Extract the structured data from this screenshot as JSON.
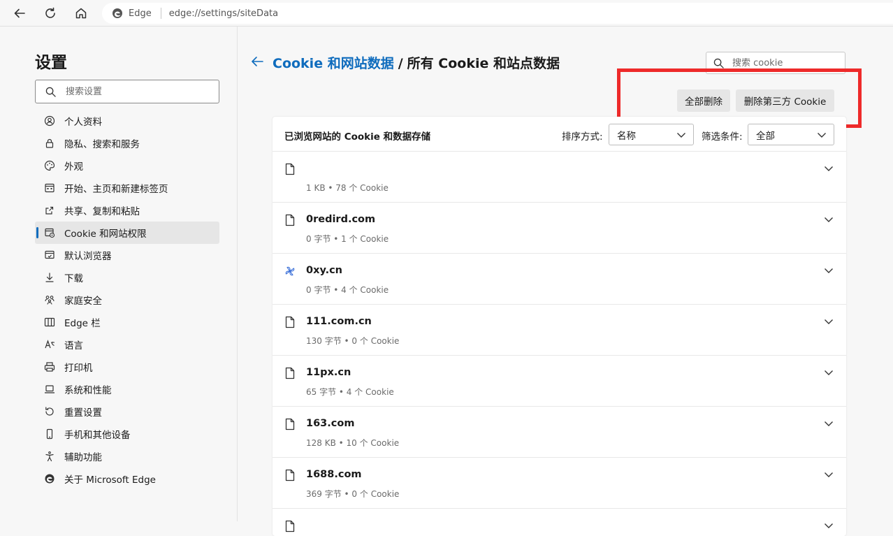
{
  "browser": {
    "site_label": "Edge",
    "url": "edge://settings/siteData"
  },
  "sidebar": {
    "title": "设置",
    "search_placeholder": "搜索设置",
    "items": [
      {
        "label": "个人资料",
        "icon": "profile-icon"
      },
      {
        "label": "隐私、搜索和服务",
        "icon": "lock-icon"
      },
      {
        "label": "外观",
        "icon": "palette-icon"
      },
      {
        "label": "开始、主页和新建标签页",
        "icon": "start-page-icon"
      },
      {
        "label": "共享、复制和粘贴",
        "icon": "share-icon"
      },
      {
        "label": "Cookie 和网站权限",
        "icon": "site-permissions-icon",
        "active": true
      },
      {
        "label": "默认浏览器",
        "icon": "default-browser-icon"
      },
      {
        "label": "下载",
        "icon": "download-icon"
      },
      {
        "label": "家庭安全",
        "icon": "family-icon"
      },
      {
        "label": "Edge 栏",
        "icon": "edge-bar-icon"
      },
      {
        "label": "语言",
        "icon": "language-icon"
      },
      {
        "label": "打印机",
        "icon": "printer-icon"
      },
      {
        "label": "系统和性能",
        "icon": "laptop-icon"
      },
      {
        "label": "重置设置",
        "icon": "reset-icon"
      },
      {
        "label": "手机和其他设备",
        "icon": "phone-icon"
      },
      {
        "label": "辅助功能",
        "icon": "accessibility-icon"
      },
      {
        "label": "关于 Microsoft Edge",
        "icon": "edge-logo-icon"
      }
    ]
  },
  "main": {
    "breadcrumb_link": "Cookie 和网站数据",
    "breadcrumb_sep": "/",
    "breadcrumb_current": "所有 Cookie 和站点数据",
    "search_placeholder": "搜索 cookie",
    "delete_all_label": "全部删除",
    "delete_third_party_label": "删除第三方 Cookie",
    "panel_title": "已浏览网站的 Cookie 和数据存储",
    "sort_label": "排序方式:",
    "sort_value": "名称",
    "filter_label": "筛选条件:",
    "filter_value": "全部",
    "sites": [
      {
        "name": "",
        "meta": "1 KB • 78 个 Cookie",
        "icon": "file-icon"
      },
      {
        "name": "0redird.com",
        "meta": "0 字节 • 1 个 Cookie",
        "icon": "file-icon"
      },
      {
        "name": "0xy.cn",
        "meta": "0 字节 • 4 个 Cookie",
        "icon": "pinwheel-icon"
      },
      {
        "name": "111.com.cn",
        "meta": "130 字节 • 0 个 Cookie",
        "icon": "file-icon"
      },
      {
        "name": "11px.cn",
        "meta": "65 字节 • 4 个 Cookie",
        "icon": "file-icon"
      },
      {
        "name": "163.com",
        "meta": "128 KB • 10 个 Cookie",
        "icon": "file-icon"
      },
      {
        "name": "1688.com",
        "meta": "369 字节 • 0 个 Cookie",
        "icon": "file-icon"
      },
      {
        "name": "",
        "meta": "",
        "icon": "file-icon"
      }
    ]
  },
  "colors": {
    "accent": "#0f6cbd",
    "highlight": "#ee2a2a"
  }
}
